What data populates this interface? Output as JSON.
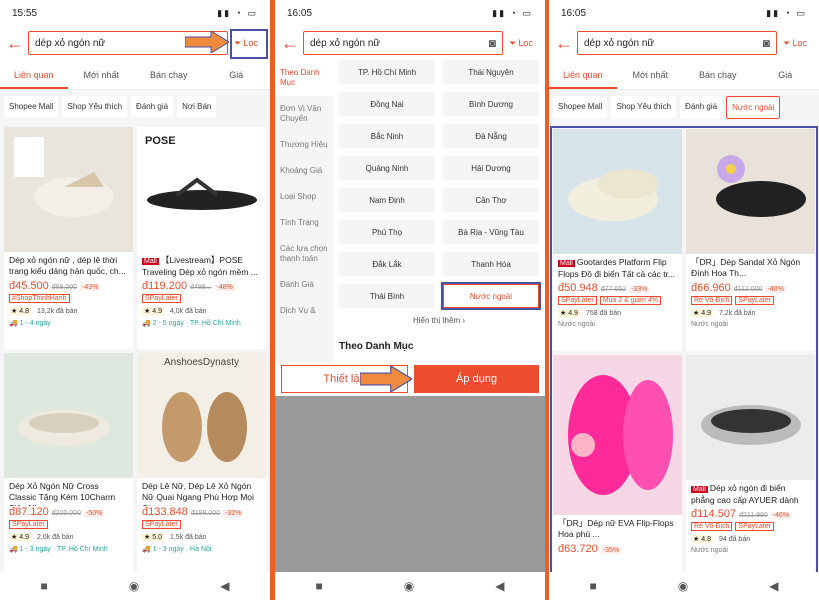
{
  "query": "dép xỏ ngón nữ",
  "filter_label": "Lọc",
  "tabs": [
    "Liên quan",
    "Mới nhất",
    "Bán chạy",
    "Giá"
  ],
  "p1": {
    "time": "15:55",
    "chips": [
      "Shopee Mall",
      "Shop Yêu thích",
      "Đánh giá",
      "Nơi Bán"
    ],
    "products": [
      {
        "title": "Dép xỏ ngón nữ , dép lê thời trang kiểu dáng hàn quốc, ch...",
        "price": "đ45.500",
        "old": "đ68.000",
        "disc": "-43%",
        "tag": "#ShopThinhHanh",
        "rating": "4.8",
        "sold": "13,2k đã bán",
        "ship": "1 - 4 ngày",
        "loc": ""
      },
      {
        "title": "【Livestream】POSE Traveling Dép xỏ ngón mềm ...",
        "price": "đ119.200",
        "old": "đ498...",
        "disc": "-48%",
        "tag": "SPayLater",
        "rating": "4.9",
        "sold": "4,0k đã bán",
        "ship": "2 - 5 ngày",
        "loc": "TP. Hồ Chí Minh",
        "mall": "Mall",
        "brand": "POSE"
      },
      {
        "title": "Dép Xỏ Ngón Nữ Cross Classic Tặng Kèm 10Charm Siêu Nhẹ",
        "price": "đ87.120",
        "old": "đ220.000",
        "disc": "-50%",
        "tag": "SPayLater",
        "rating": "4.9",
        "sold": "2,0k đã bán",
        "ship": "1 - 3 ngày",
        "loc": "TP. Hồ Chí Minh"
      },
      {
        "title": "Dép Lê Nữ, Dép Lê Xỏ Ngón Nữ Quai Ngang Phù Hợp Mọi Ot...",
        "price": "đ133.848",
        "old": "đ198.000",
        "disc": "-32%",
        "tag": "SPayLater",
        "rating": "5.0",
        "sold": "1,5k đã bán",
        "ship": "1 - 3 ngày",
        "loc": "Hà Nội",
        "brand": "AnshoesDynasty"
      }
    ]
  },
  "p2": {
    "time": "16:05",
    "provinces": [
      "TP. Hồ Chí Minh",
      "Thái Nguyên",
      "Đồng Nai",
      "Bình Dương",
      "Bắc Ninh",
      "Đà Nẵng",
      "Quảng Ninh",
      "Hải Dương",
      "Nam Định",
      "Cần Thơ",
      "Phú Thọ",
      "Bà Rịa - Vũng Tàu",
      "Đắk Lắk",
      "Thanh Hóa",
      "Thái Bình",
      "Nước ngoài"
    ],
    "side": [
      "Theo Danh Mục",
      "Đơn Vị Vận Chuyển",
      "Thương Hiệu",
      "Khoảng Giá",
      "Loại Shop",
      "Tình Trạng",
      "Các lựa chọn thanh toán",
      "Đánh Giá",
      "Dịch Vụ &"
    ],
    "show_more": "Hiển thị thêm",
    "category_head": "Theo Danh Mục",
    "reset": "Thiết lập",
    "apply": "Áp dụng"
  },
  "p3": {
    "time": "16:05",
    "chips": [
      "Shopee Mall",
      "Shop Yêu thích",
      "Đánh giá",
      "Nước ngoài"
    ],
    "products": [
      {
        "title": "Gootardes Platform Flip Flops Đồ đi biển Tất cả các tr...",
        "price": "đ50.948",
        "old": "đ77.652",
        "disc": "-33%",
        "tag": "SPayLater",
        "tag2": "Mua 2 & giảm 4%",
        "rating": "4.9",
        "sold": "758 đã bán",
        "ship": "",
        "loc": "Nước ngoài",
        "mall": "Mall"
      },
      {
        "title": "「DR」Dép Sandal Xỏ Ngón Đính Hoa Th...",
        "price": "đ66.960",
        "old": "đ112.000",
        "disc": "-40%",
        "tag": "Rẻ Vô Địch",
        "tag2": "SPayLater",
        "rating": "4.9",
        "sold": "7,2k đã bán",
        "ship": "",
        "loc": "Nước ngoài"
      },
      {
        "title": "「DR」Dép nữ EVA Flip-Flops Hoa phù ...",
        "price": "đ63.720",
        "old": "",
        "disc": "-35%",
        "tag": "",
        "rating": "",
        "sold": "",
        "ship": "",
        "loc": ""
      },
      {
        "title": "Dép xỏ ngón đi biển phẳng cao cấp AYUER dành c...",
        "price": "đ114.507",
        "old": "đ211.980",
        "disc": "-46%",
        "tag": "Rẻ Vô Địch",
        "tag2": "SPayLater",
        "rating": "4.8",
        "sold": "94 đã bán",
        "ship": "",
        "loc": "Nước ngoài",
        "mall": "Mall"
      }
    ]
  }
}
